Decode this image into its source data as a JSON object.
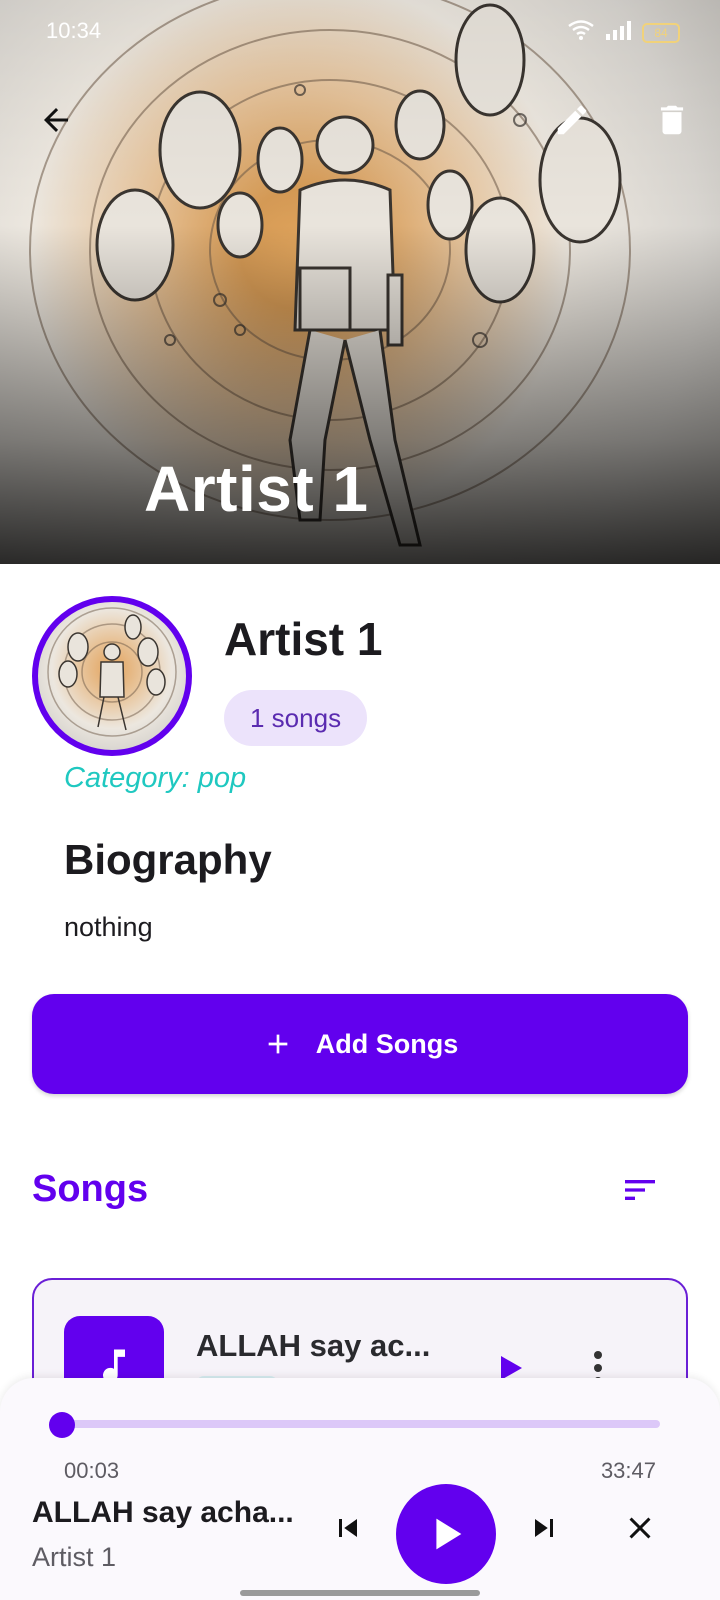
{
  "status_bar": {
    "time": "10:34",
    "battery": "84"
  },
  "hero": {
    "title": "Artist 1"
  },
  "artist": {
    "name": "Artist 1",
    "song_count": "1 songs",
    "category": "Category: pop"
  },
  "biography": {
    "title": "Biography",
    "text": "nothing"
  },
  "add_songs": {
    "label": "Add Songs"
  },
  "songs_section": {
    "title": "Songs"
  },
  "songs": [
    {
      "title": "ALLAH say ac..."
    }
  ],
  "player": {
    "current_time": "00:03",
    "total_time": "33:47",
    "progress": 0.0015,
    "title": "ALLAH say acha...",
    "artist": "Artist 1"
  },
  "colors": {
    "primary": "#6200ee",
    "category": "#1fc8c0",
    "chip_bg": "#ece3fb"
  },
  "icons": [
    "back-arrow-icon",
    "edit-icon",
    "delete-icon",
    "add-icon",
    "sort-icon",
    "music-note-icon",
    "play-icon",
    "more-vert-icon",
    "skip-previous-icon",
    "skip-next-icon",
    "close-icon"
  ]
}
